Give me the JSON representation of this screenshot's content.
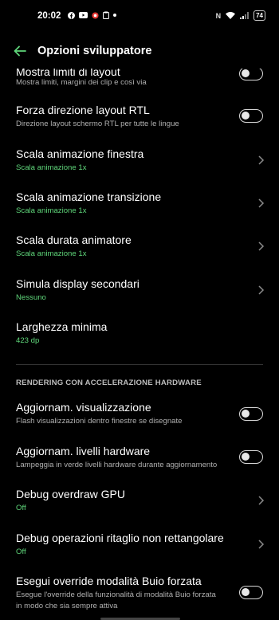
{
  "status_bar": {
    "time": "20:02",
    "left_icons": [
      "facebook-icon",
      "youtube-icon",
      "record-icon",
      "clipboard-icon",
      "dot-icon"
    ],
    "nfc_label": "N",
    "battery": "74"
  },
  "app_bar": {
    "title": "Opzioni sviluppatore"
  },
  "rows_top": [
    {
      "title": "Mostra limiti di layout",
      "subtitle": "Mostra limiti, margini dei clip e così via",
      "control": "toggle",
      "on": false
    },
    {
      "title": "Forza direzione layout RTL",
      "subtitle": "Direzione layout schermo RTL per tutte le lingue",
      "control": "toggle",
      "on": false
    },
    {
      "title": "Scala animazione finestra",
      "subtitle": "Scala animazione 1x",
      "control": "chevron"
    },
    {
      "title": "Scala animazione transizione",
      "subtitle": "Scala animazione 1x",
      "control": "chevron"
    },
    {
      "title": "Scala durata animatore",
      "subtitle": "Scala animazione 1x",
      "control": "chevron"
    },
    {
      "title": "Simula display secondari",
      "subtitle": "Nessuno",
      "control": "chevron"
    },
    {
      "title": "Larghezza minima",
      "subtitle": "423 dp",
      "control": "none"
    }
  ],
  "section": {
    "header": "RENDERING CON ACCELERAZIONE HARDWARE"
  },
  "rows_bottom": [
    {
      "title": "Aggiornam. visualizzazione",
      "subtitle": "Flash visualizzazioni dentro finestre se disegnate",
      "control": "toggle",
      "on": false
    },
    {
      "title": "Aggiornam. livelli hardware",
      "subtitle": "Lampeggia in verde livelli hardware durante aggiornamento",
      "control": "toggle",
      "on": false
    },
    {
      "title": "Debug overdraw GPU",
      "subtitle": "Off",
      "control": "chevron"
    },
    {
      "title": "Debug operazioni ritaglio non rettangolare",
      "subtitle": "Off",
      "control": "chevron"
    },
    {
      "title": "Esegui override modalità Buio forzata",
      "subtitle_line1": "Esegue l'override della funzionalità di modalità Buio forzata",
      "subtitle_line2": "in modo che sia sempre attiva",
      "control": "toggle",
      "on": false
    }
  ],
  "colors": {
    "accent_green": "#5fd67a",
    "background": "#000000"
  }
}
